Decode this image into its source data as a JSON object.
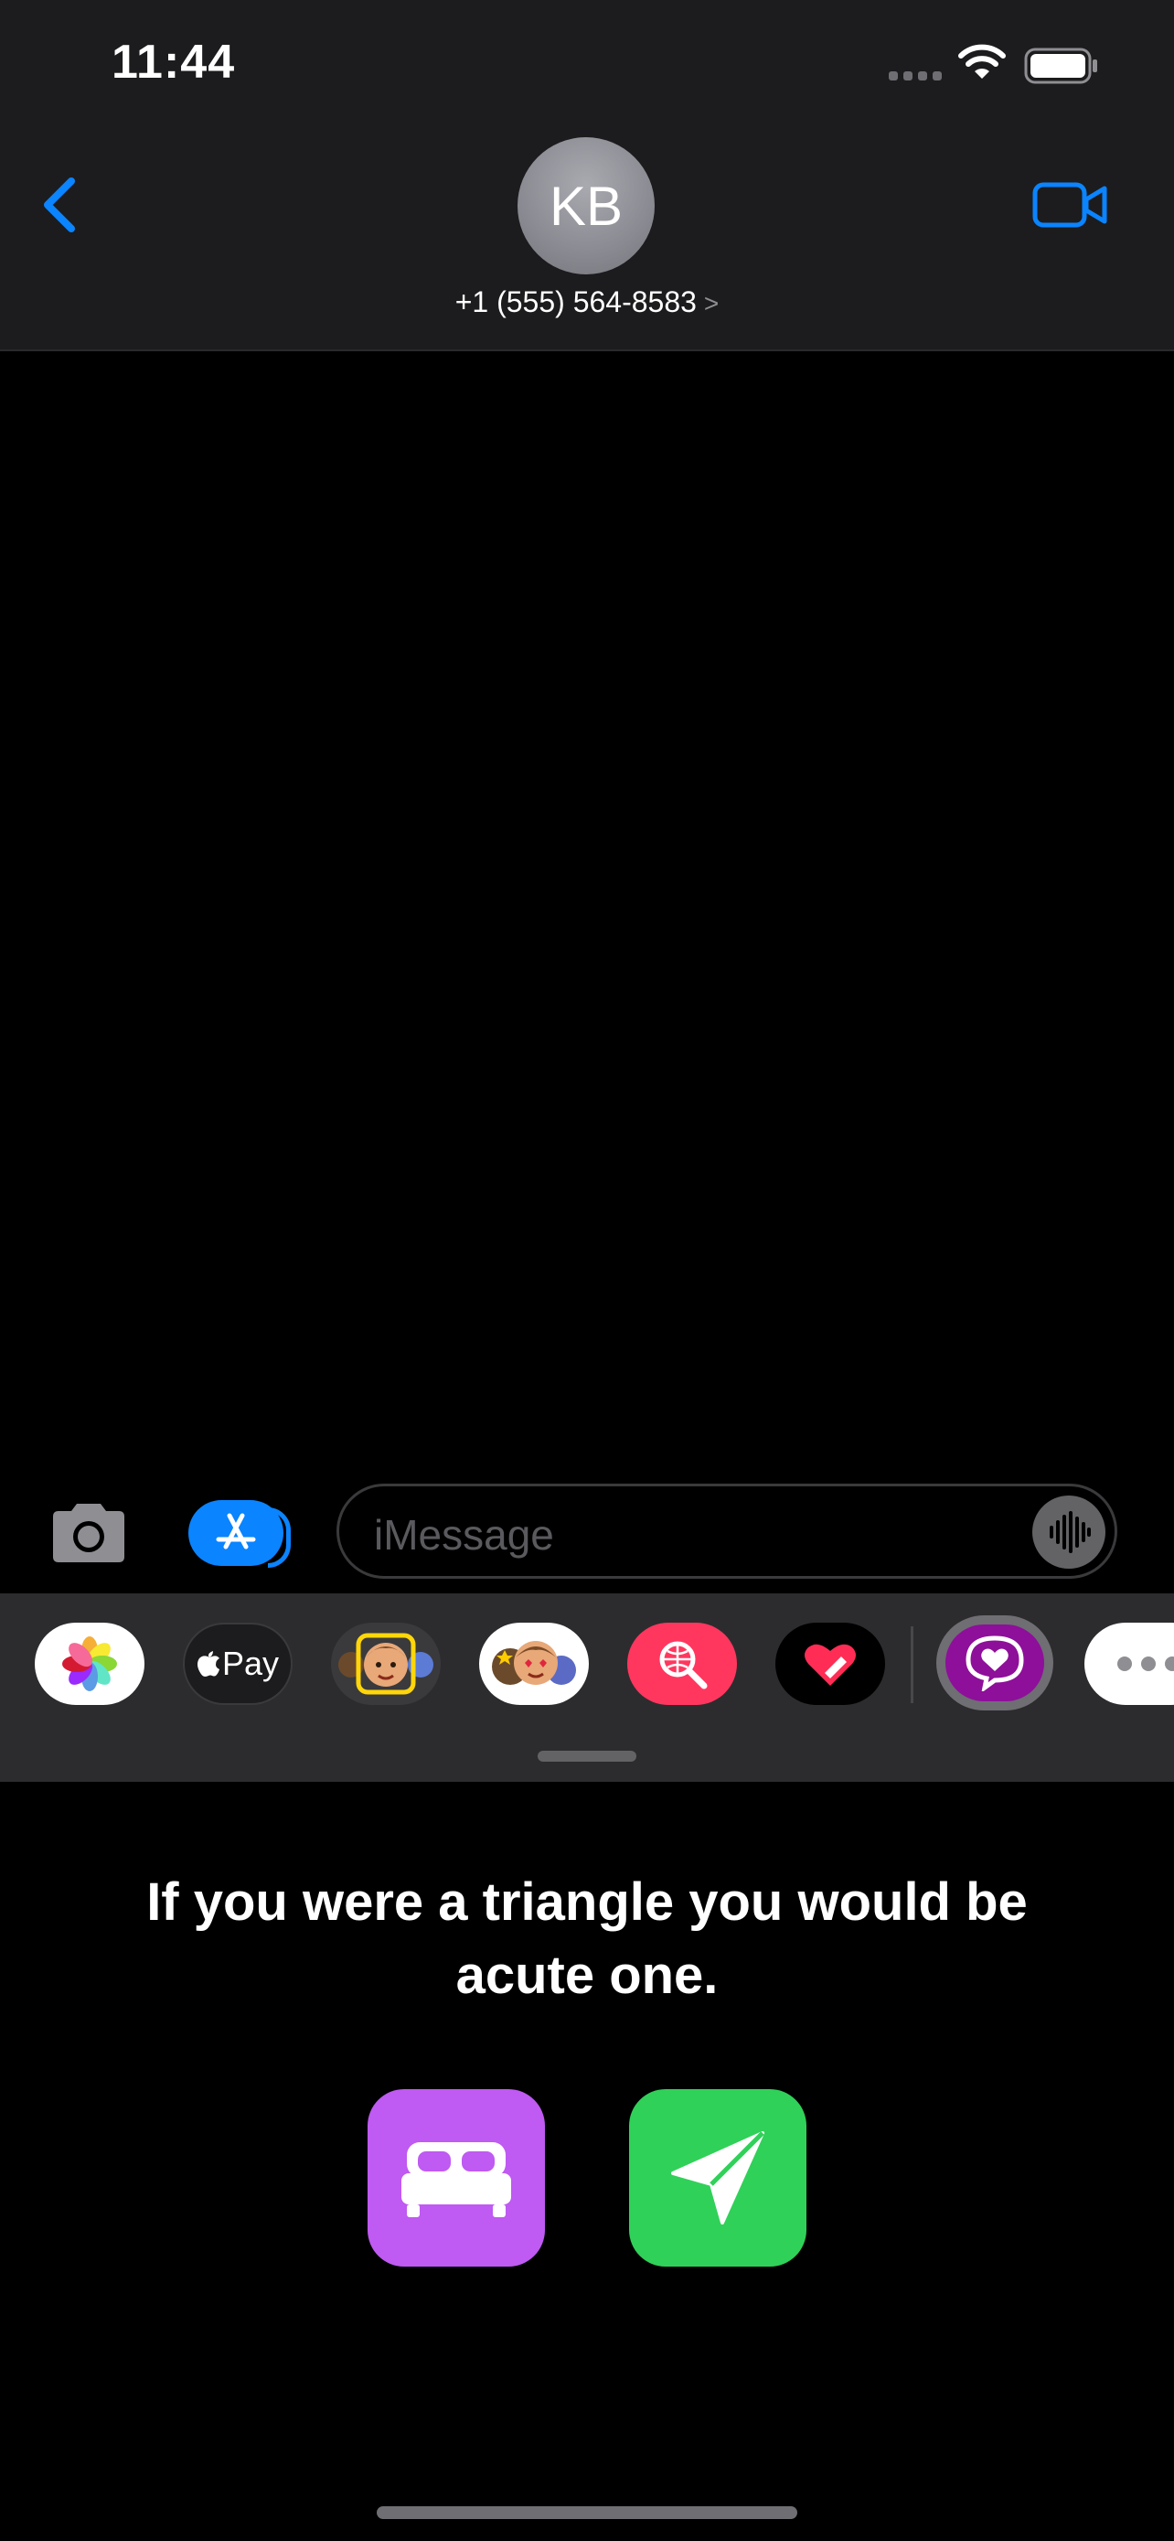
{
  "status_bar": {
    "time": "11:44"
  },
  "header": {
    "avatar_initials": "KB",
    "contact": "+1 (555) 564-8583",
    "chevron": ">"
  },
  "input": {
    "placeholder": "iMessage"
  },
  "app_strip": {
    "apple_pay_label": "Pay"
  },
  "panel": {
    "pickup_line": "If you were a triangle you would be acute one."
  },
  "icons": [
    "back-chevron-icon",
    "video-camera-icon",
    "camera-icon",
    "app-store-icon",
    "waveform-icon",
    "photos-icon",
    "apple-pay-icon",
    "memoji-icon",
    "memoji-stickers-icon",
    "image-search-icon",
    "digital-touch-icon",
    "heart-bubble-icon",
    "more-icon",
    "bed-icon",
    "send-icon"
  ],
  "colors": {
    "accent": "#0a84ff",
    "bed_button": "#bf5af2",
    "send_button": "#30d158",
    "search_app": "#ff375f",
    "heart_app": "#8e0f9a"
  }
}
